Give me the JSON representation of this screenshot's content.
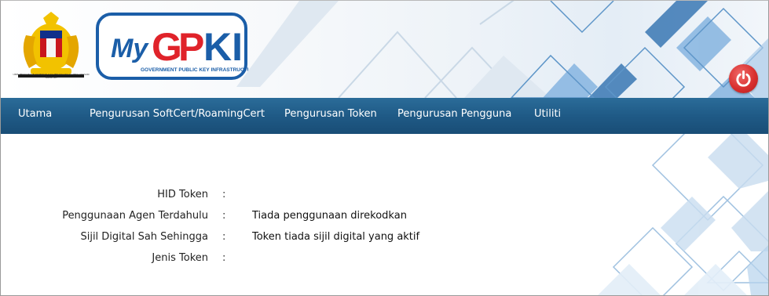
{
  "header": {
    "crest_caption": "UNIT PEMODENAN TADBIRAN DAN PERANCANGAN PENGURUSAN MALAYSIA",
    "logo_text": "MyGPKI",
    "logo_subtitle": "GOVERNMENT PUBLIC KEY INFRASTRUCTURE",
    "power_icon": "power-icon"
  },
  "nav": {
    "items": [
      {
        "label": "Utama"
      },
      {
        "label": "Pengurusan SoftCert/RoamingCert"
      },
      {
        "label": "Pengurusan Token"
      },
      {
        "label": "Pengurusan Pengguna"
      },
      {
        "label": "Utiliti"
      }
    ]
  },
  "details": [
    {
      "label": "HID Token",
      "colon": ":",
      "value": ""
    },
    {
      "label": "Penggunaan Agen Terdahulu",
      "colon": ":",
      "value": "Tiada penggunaan direkodkan"
    },
    {
      "label": "Sijil Digital Sah Sehingga",
      "colon": ":",
      "value": "Token tiada sijil digital yang aktif"
    },
    {
      "label": "Jenis Token",
      "colon": ":",
      "value": ""
    }
  ],
  "colors": {
    "nav_bg": "#1f5a86",
    "power_red": "#d9302f",
    "logo_blue": "#1b5ea8",
    "logo_red": "#e0232a"
  }
}
